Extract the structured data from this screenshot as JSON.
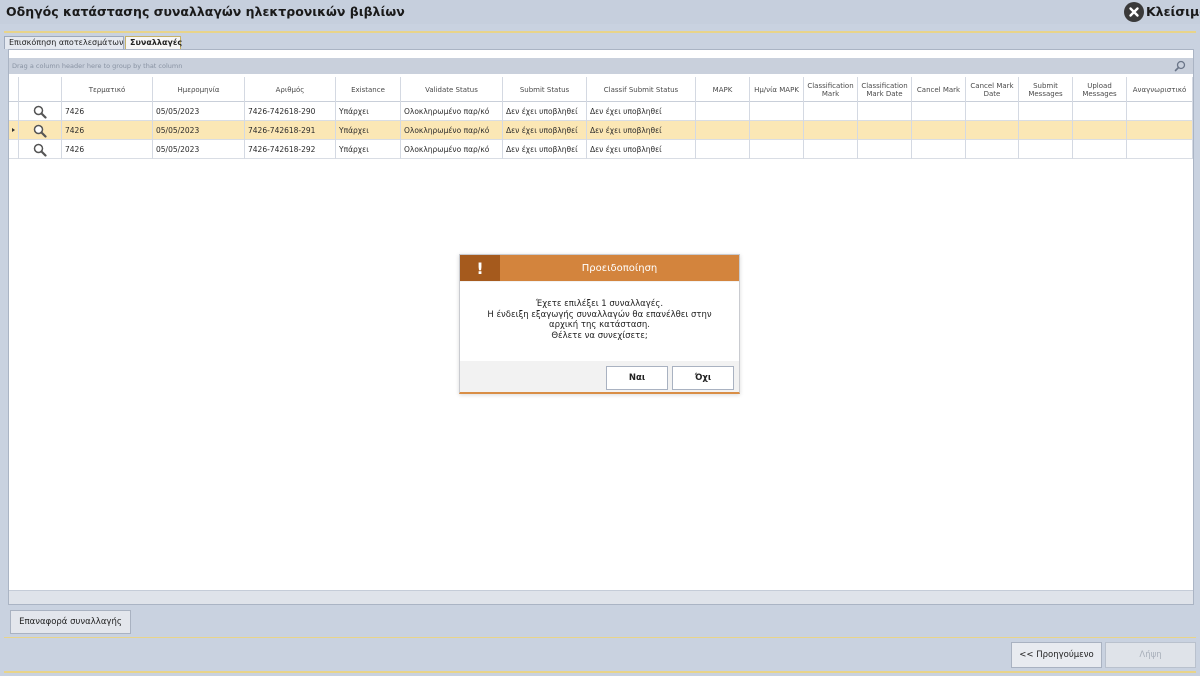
{
  "window": {
    "title": "Οδηγός κατάστασης συναλλαγών ηλεκτρονικών βιβλίων",
    "close_label": "Κλείσιμο"
  },
  "tabs": [
    {
      "label": "Επισκόπηση αποτελεσμάτων",
      "active": false
    },
    {
      "label": "Συναλλαγές",
      "active": true
    }
  ],
  "grid": {
    "group_hint": "Drag a column header here to group by that column",
    "columns": [
      "Τερματικό",
      "Ημερομηνία",
      "Αριθμός",
      "Existance",
      "Validate Status",
      "Submit Status",
      "Classif Submit Status",
      "MAPK",
      "Ημ/νία MAPK",
      "Classification Mark",
      "Classification Mark Date",
      "Cancel Mark",
      "Cancel Mark Date",
      "Submit Messages",
      "Upload Messages",
      "Αναγνωριστικό"
    ],
    "rows": [
      {
        "terminal": "7426",
        "date": "05/05/2023",
        "number": "7426-742618-290",
        "existance": "Υπάρχει",
        "validate": "Ολοκληρωμένο παρ/κό",
        "submit": "Δεν έχει υποβληθεί",
        "classif": "Δεν έχει υποβληθεί",
        "selected": false
      },
      {
        "terminal": "7426",
        "date": "05/05/2023",
        "number": "7426-742618-291",
        "existance": "Υπάρχει",
        "validate": "Ολοκληρωμένο παρ/κό",
        "submit": "Δεν έχει υποβληθεί",
        "classif": "Δεν έχει υποβληθεί",
        "selected": true
      },
      {
        "terminal": "7426",
        "date": "05/05/2023",
        "number": "7426-742618-292",
        "existance": "Υπάρχει",
        "validate": "Ολοκληρωμένο παρ/κό",
        "submit": "Δεν έχει υποβληθεί",
        "classif": "Δεν έχει υποβληθεί",
        "selected": false
      }
    ]
  },
  "buttons": {
    "restore": "Επαναφορά συναλλαγής",
    "previous": "<< Προηγούμενο",
    "next": "Λήψη"
  },
  "dialog": {
    "title": "Προειδοποίηση",
    "icon": "!",
    "lines": [
      "Έχετε επιλέξει 1 συναλλαγές.",
      "Η ένδειξη εξαγωγής συναλλαγών θα επανέλθει στην",
      "αρχική της κατάσταση.",
      "Θέλετε να συνεχίσετε;"
    ],
    "yes": "Ναι",
    "no": "Όχι"
  },
  "colors": {
    "selected_row": "#fbe7b5",
    "dialog_header": "#d3843d",
    "dialog_icon_bg": "#a55a1d",
    "accent_line": "#e8d48a"
  }
}
